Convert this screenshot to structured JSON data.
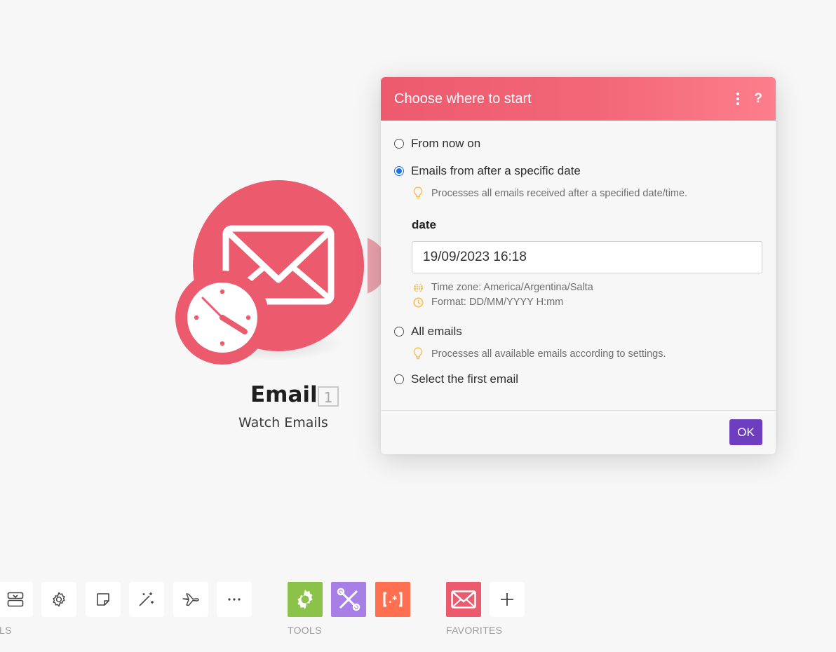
{
  "module": {
    "title": "Email",
    "number": "1",
    "subtitle": "Watch Emails",
    "icon": "envelope-icon",
    "badge_icon": "clock-icon",
    "color": "#ec5a6e"
  },
  "dialog": {
    "title": "Choose where to start",
    "menu_icon": "kebab-menu-icon",
    "help_label": "?",
    "options": [
      {
        "label": "From now on",
        "checked": false
      },
      {
        "label": "Emails from after a specific date",
        "checked": true,
        "hint": "Processes all emails received after a specified date/time."
      },
      {
        "label": "All emails",
        "checked": false,
        "hint": "Processes all available emails according to settings."
      },
      {
        "label": "Select the first email",
        "checked": false
      }
    ],
    "date_field": {
      "label": "date",
      "value": "19/09/2023 16:18",
      "timezone": "Time zone: America/Argentina/Salta",
      "format": "Format: DD/MM/YYYY H:mm"
    },
    "ok_label": "OK",
    "colors": {
      "header": "#ed5a6e",
      "ok": "#6d3fc0",
      "hint_icon": "#f5c45e"
    }
  },
  "toolbar": {
    "partial_label": "LS",
    "buttons": [
      {
        "icon": "scenario-io-icon"
      },
      {
        "icon": "gear-icon"
      },
      {
        "icon": "note-icon"
      },
      {
        "icon": "magic-wand-icon"
      },
      {
        "icon": "airplane-icon"
      },
      {
        "icon": "more-icon"
      }
    ],
    "tools_label": "TOOLS",
    "tools": [
      {
        "icon": "flow-control-gear-icon",
        "color": "#8bc34a"
      },
      {
        "icon": "tools-icon",
        "color": "#a77fe6"
      },
      {
        "icon": "text-parser-icon",
        "color": "#ff6f50"
      }
    ],
    "favorites_label": "FAVORITES",
    "favorites": [
      {
        "icon": "email-app-icon",
        "color": "#ec5a6e"
      },
      {
        "icon": "add-icon"
      }
    ]
  }
}
